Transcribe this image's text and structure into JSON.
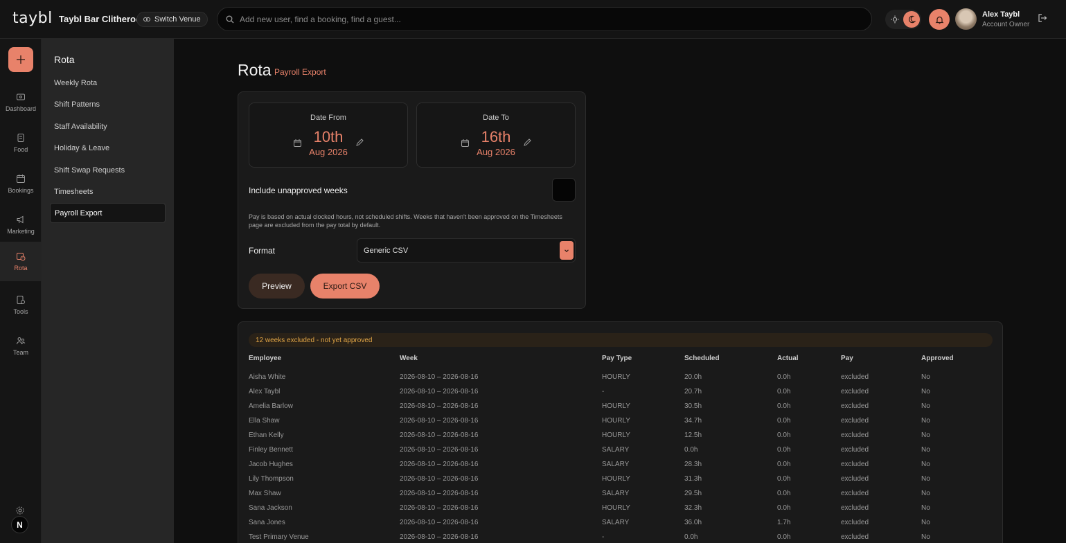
{
  "topbar": {
    "logo": "taybl",
    "venue_name": "Taybl Bar Clitheroe",
    "switch_venue": "Switch Venue",
    "search_placeholder": "Add new user, find a booking, find a guest...",
    "user_name": "Alex Taybl",
    "user_role": "Account Owner"
  },
  "nav": [
    {
      "label": "Dashboard",
      "icon": "dashboard-icon"
    },
    {
      "label": "Food",
      "icon": "food-icon"
    },
    {
      "label": "Bookings",
      "icon": "bookings-icon"
    },
    {
      "label": "Marketing",
      "icon": "megaphone-icon"
    },
    {
      "label": "Rota",
      "icon": "rota-icon",
      "active": true
    },
    {
      "label": "Tools",
      "icon": "tools-icon"
    },
    {
      "label": "Team",
      "icon": "team-icon"
    }
  ],
  "nav_badge": "N",
  "subnav": {
    "title": "Rota",
    "items": [
      "Weekly Rota",
      "Shift Patterns",
      "Staff Availability",
      "Holiday & Leave",
      "Shift Swap Requests",
      "Timesheets",
      "Payroll Export"
    ],
    "active": "Payroll Export"
  },
  "page": {
    "title": "Rota",
    "subtitle": "Payroll Export"
  },
  "form": {
    "date_from": {
      "label": "Date From",
      "day": "10th",
      "month": "Aug 2026"
    },
    "date_to": {
      "label": "Date To",
      "day": "16th",
      "month": "Aug 2026"
    },
    "include_label": "Include unapproved weeks",
    "note": "Pay is based on actual clocked hours, not scheduled shifts. Weeks that haven't been approved on the Timesheets page are excluded from the pay total by default.",
    "format_label": "Format",
    "format_value": "Generic CSV",
    "preview_btn": "Preview",
    "export_btn": "Export CSV"
  },
  "table": {
    "banner": "12 weeks excluded - not yet approved",
    "headers": [
      "Employee",
      "Week",
      "Pay Type",
      "Scheduled",
      "Actual",
      "Pay",
      "Approved"
    ],
    "rows": [
      [
        "Aisha White",
        "2026-08-10 – 2026-08-16",
        "HOURLY",
        "20.0h",
        "0.0h",
        "excluded",
        "No"
      ],
      [
        "Alex Taybl",
        "2026-08-10 – 2026-08-16",
        "-",
        "20.7h",
        "0.0h",
        "excluded",
        "No"
      ],
      [
        "Amelia Barlow",
        "2026-08-10 – 2026-08-16",
        "HOURLY",
        "30.5h",
        "0.0h",
        "excluded",
        "No"
      ],
      [
        "Ella Shaw",
        "2026-08-10 – 2026-08-16",
        "HOURLY",
        "34.7h",
        "0.0h",
        "excluded",
        "No"
      ],
      [
        "Ethan Kelly",
        "2026-08-10 – 2026-08-16",
        "HOURLY",
        "12.5h",
        "0.0h",
        "excluded",
        "No"
      ],
      [
        "Finley Bennett",
        "2026-08-10 – 2026-08-16",
        "SALARY",
        "0.0h",
        "0.0h",
        "excluded",
        "No"
      ],
      [
        "Jacob Hughes",
        "2026-08-10 – 2026-08-16",
        "SALARY",
        "28.3h",
        "0.0h",
        "excluded",
        "No"
      ],
      [
        "Lily Thompson",
        "2026-08-10 – 2026-08-16",
        "HOURLY",
        "31.3h",
        "0.0h",
        "excluded",
        "No"
      ],
      [
        "Max Shaw",
        "2026-08-10 – 2026-08-16",
        "SALARY",
        "29.5h",
        "0.0h",
        "excluded",
        "No"
      ],
      [
        "Sana Jackson",
        "2026-08-10 – 2026-08-16",
        "HOURLY",
        "32.3h",
        "0.0h",
        "excluded",
        "No"
      ],
      [
        "Sana Jones",
        "2026-08-10 – 2026-08-16",
        "SALARY",
        "36.0h",
        "1.7h",
        "excluded",
        "No"
      ],
      [
        "Test Primary Venue",
        "2026-08-10 – 2026-08-16",
        "-",
        "0.0h",
        "0.0h",
        "excluded",
        "No"
      ]
    ]
  },
  "colors": {
    "accent": "#e8826a",
    "warning": "#e2a646",
    "background": "#0f0f0f"
  }
}
